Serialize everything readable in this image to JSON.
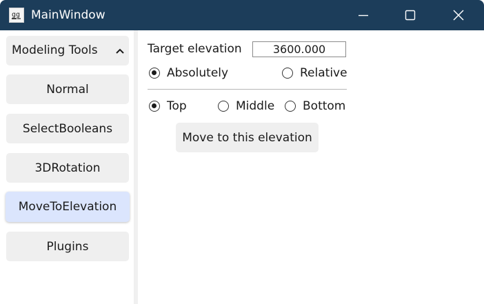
{
  "window": {
    "title": "MainWindow",
    "titlebar_color": "#1c3d5a",
    "controls": [
      "minimize-icon",
      "maximize-icon",
      "close-icon"
    ]
  },
  "sidebar": {
    "section_title": "Modeling Tools",
    "section_icon": "chevron-up-icon",
    "items": [
      {
        "label": "Normal",
        "active": false
      },
      {
        "label": "SelectBooleans",
        "active": false
      },
      {
        "label": "3DRotation",
        "active": false
      },
      {
        "label": "MoveToElevation",
        "active": true
      },
      {
        "label": "Plugins",
        "active": false
      }
    ],
    "active_color": "#dbe5fd"
  },
  "panel": {
    "target_label": "Target elevation",
    "target_value": "3600.000",
    "mode_options": [
      {
        "label": "Absolutely",
        "checked": true
      },
      {
        "label": "Relative",
        "checked": false
      }
    ],
    "position_options": [
      {
        "label": "Top",
        "checked": true
      },
      {
        "label": "Middle",
        "checked": false
      },
      {
        "label": "Bottom",
        "checked": false
      }
    ],
    "action_label": "Move to this elevation"
  }
}
